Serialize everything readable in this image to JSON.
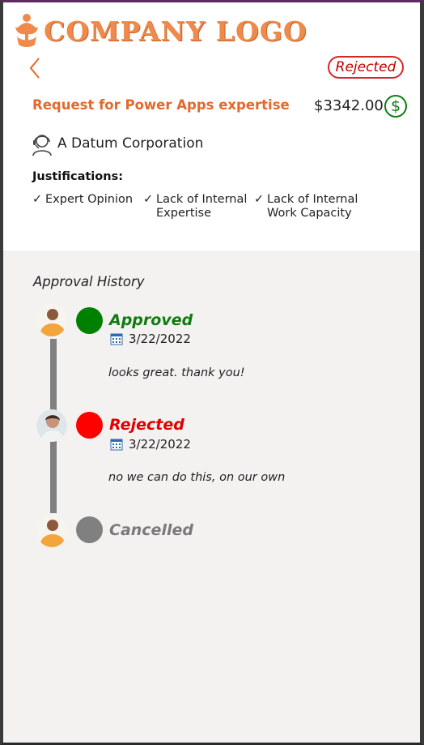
{
  "header": {
    "logo_text": "COMPANY LOGO"
  },
  "request": {
    "status": "Rejected",
    "title": "Request for Power Apps expertise",
    "amount": "$3342.00",
    "currency_icon": "$",
    "vendor": "A Datum Corporation",
    "justifications_label": "Justifications:",
    "justifications": [
      "Expert Opinion",
      "Lack of Internal\nExpertise",
      "Lack of Internal\nWork Capacity"
    ]
  },
  "history": {
    "title": "Approval History",
    "entries": [
      {
        "status": "Approved",
        "color": "#008000",
        "text_color": "#107c10",
        "date": "3/22/2022",
        "comment": "looks great. thank you!"
      },
      {
        "status": "Rejected",
        "color": "#ff0000",
        "text_color": "#e00000",
        "date": "3/22/2022",
        "comment": "no we can do this, on our own"
      },
      {
        "status": "Cancelled",
        "color": "#808080",
        "text_color": "#7a7a7a",
        "date": "",
        "comment": ""
      }
    ]
  },
  "colors": {
    "accent": "#e2692a",
    "rejected": "#d62728",
    "approved": "#107c10"
  }
}
